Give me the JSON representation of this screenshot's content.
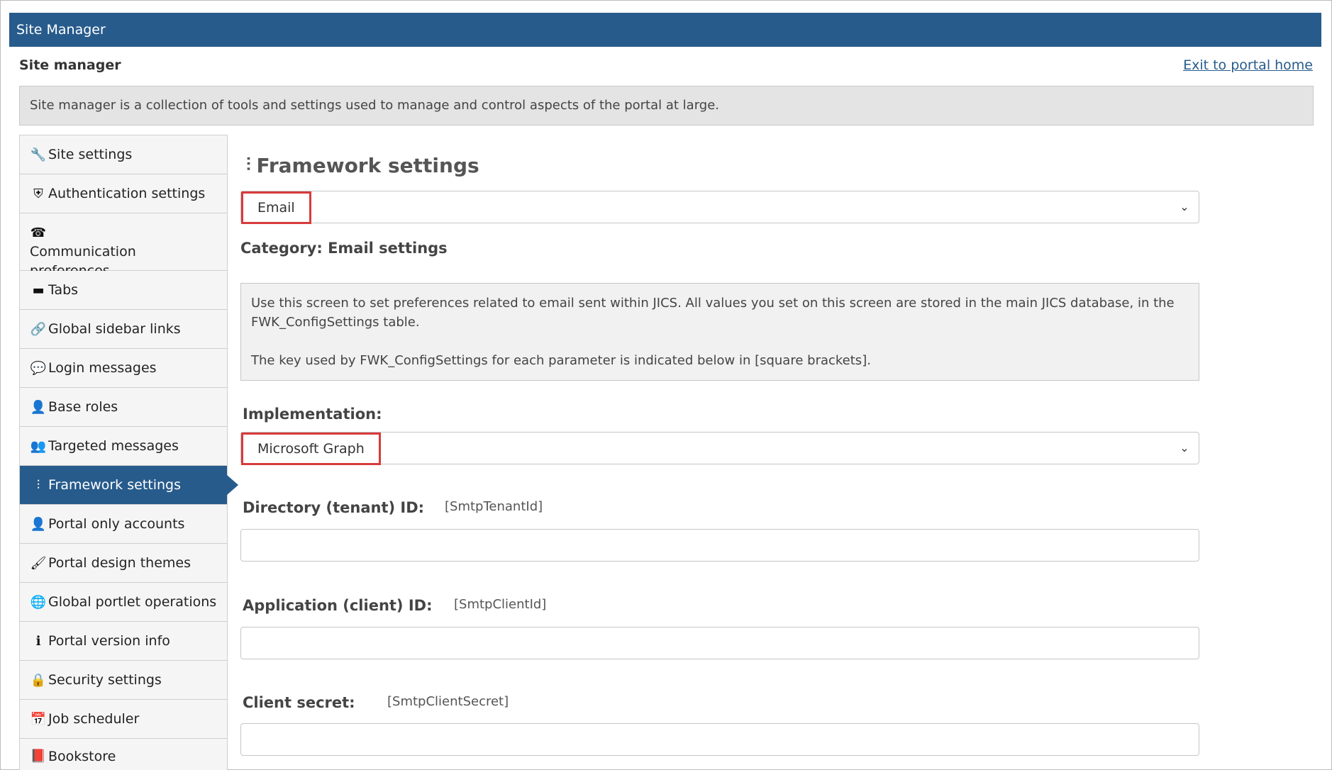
{
  "window": {
    "title": "Site Manager"
  },
  "header": {
    "subtitle": "Site manager",
    "exit_link": "Exit to portal home"
  },
  "intro": "Site manager is a collection of tools and settings used to manage and control aspects of the portal at large.",
  "sidebar": {
    "items": [
      {
        "label": "Site settings",
        "icon": "wrench-icon",
        "glyph": "🔧"
      },
      {
        "label": "Authentication settings",
        "icon": "shield-icon",
        "glyph": "⛨"
      },
      {
        "label": "Communication preferences",
        "icon": "phone-icon",
        "glyph": "☎"
      },
      {
        "label": "Tabs",
        "icon": "folder-icon",
        "glyph": "▬"
      },
      {
        "label": "Global sidebar links",
        "icon": "link-icon",
        "glyph": "🔗"
      },
      {
        "label": "Login messages",
        "icon": "comment-icon",
        "glyph": "💬"
      },
      {
        "label": "Base roles",
        "icon": "user-icon",
        "glyph": "👤"
      },
      {
        "label": "Targeted messages",
        "icon": "users-icon",
        "glyph": "👥"
      },
      {
        "label": "Framework settings",
        "icon": "sliders-icon",
        "glyph": "⫶",
        "active": true
      },
      {
        "label": "Portal only accounts",
        "icon": "user-key-icon",
        "glyph": "👤"
      },
      {
        "label": "Portal design themes",
        "icon": "brush-icon",
        "glyph": "🖌"
      },
      {
        "label": "Global portlet operations",
        "icon": "globe-icon",
        "glyph": "🌐"
      },
      {
        "label": "Portal version info",
        "icon": "info-icon",
        "glyph": "ℹ"
      },
      {
        "label": "Security settings",
        "icon": "lock-icon",
        "glyph": "🔒"
      },
      {
        "label": "Job scheduler",
        "icon": "calendar-icon",
        "glyph": "📅"
      },
      {
        "label": "Bookstore",
        "icon": "book-icon",
        "glyph": "📕"
      }
    ]
  },
  "main": {
    "title": "Framework settings",
    "title_icon": "sliders-icon",
    "category_select": {
      "value": "Email"
    },
    "category_heading": "Category: Email settings",
    "note": {
      "p1": "Use this screen to set preferences related to email sent within JICS. All values you set on this screen are stored in the main JICS database, in the FWK_ConfigSettings table.",
      "p2": "The key used by FWK_ConfigSettings for each parameter is indicated below in [square brackets]."
    },
    "implementation": {
      "label": "Implementation:",
      "value": "Microsoft Graph"
    },
    "fields": [
      {
        "label": "Directory (tenant) ID:",
        "key": "[SmtpTenantId]",
        "value": ""
      },
      {
        "label": "Application (client) ID:",
        "key": "[SmtpClientId]",
        "value": ""
      },
      {
        "label": "Client secret:",
        "key": "[SmtpClientSecret]",
        "value": ""
      }
    ]
  },
  "colors": {
    "brand": "#275b8c",
    "highlight": "#d93b3b",
    "panel": "#f5f5f5"
  }
}
